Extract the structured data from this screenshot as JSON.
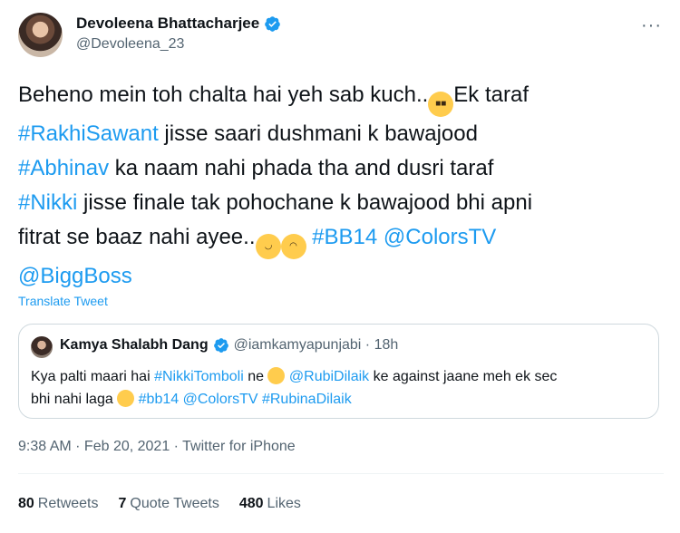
{
  "author": {
    "display_name": "Devoleena Bhattacharjee",
    "handle": "@Devoleena_23"
  },
  "tweet": {
    "lines": [
      {
        "parts": [
          {
            "t": "Beheno mein toh chalta hai yeh sab kuch.."
          },
          {
            "emoji": "sunglasses"
          },
          {
            "t": "Ek taraf"
          }
        ]
      },
      {
        "parts": [
          {
            "t": "#RakhiSawant",
            "link": true
          },
          {
            "t": " jisse saari dushmani k bawajood"
          }
        ]
      },
      {
        "parts": [
          {
            "t": "#Abhinav",
            "link": true
          },
          {
            "t": " ka naam nahi phada tha and dusri taraf"
          }
        ]
      },
      {
        "parts": [
          {
            "t": "#Nikki",
            "link": true
          },
          {
            "t": " jisse finale tak pohochane k bawajood bhi apni"
          }
        ]
      },
      {
        "parts": [
          {
            "t": "fitrat se baaz nahi ayee.."
          },
          {
            "emoji": "rofl"
          },
          {
            "emoji": "zany"
          },
          {
            "t": " "
          },
          {
            "t": "#BB14",
            "link": true
          },
          {
            "t": " "
          },
          {
            "t": "@ColorsTV",
            "link": true
          }
        ]
      },
      {
        "parts": [
          {
            "t": "@BiggBoss",
            "link": true
          }
        ]
      }
    ],
    "translate_label": "Translate Tweet"
  },
  "quoted": {
    "display_name": "Kamya Shalabh Dang",
    "handle_time": "@iamkamyapunjabi · 18h",
    "lines": [
      {
        "parts": [
          {
            "t": "Kya palti maari hai "
          },
          {
            "t": "#NikkiTomboli",
            "link": true
          },
          {
            "t": " ne "
          },
          {
            "emoji": "sweat-smile"
          },
          {
            "t": " "
          },
          {
            "t": "@RubiDilaik",
            "link": true
          },
          {
            "t": " ke against jaane meh ek sec"
          }
        ]
      },
      {
        "parts": [
          {
            "t": "bhi nahi laga "
          },
          {
            "emoji": "eye-roll"
          },
          {
            "t": " "
          },
          {
            "t": "#bb14",
            "link": true
          },
          {
            "t": " "
          },
          {
            "t": "@ColorsTV",
            "link": true
          },
          {
            "t": " "
          },
          {
            "t": "#RubinaDilaik",
            "link": true
          }
        ]
      }
    ]
  },
  "meta": {
    "time": "9:38 AM",
    "sep": " · ",
    "date": "Feb 20, 2021",
    "source": "Twitter for iPhone"
  },
  "stats": {
    "retweets_count": "80",
    "retweets_label": "Retweets",
    "quotes_count": "7",
    "quotes_label": "Quote Tweets",
    "likes_count": "480",
    "likes_label": "Likes"
  },
  "colors": {
    "accent": "#1d9bf0",
    "secondary_text": "#536471",
    "border": "#cfd9de"
  },
  "icons": [
    "verified-badge-icon",
    "more-options-icon"
  ]
}
